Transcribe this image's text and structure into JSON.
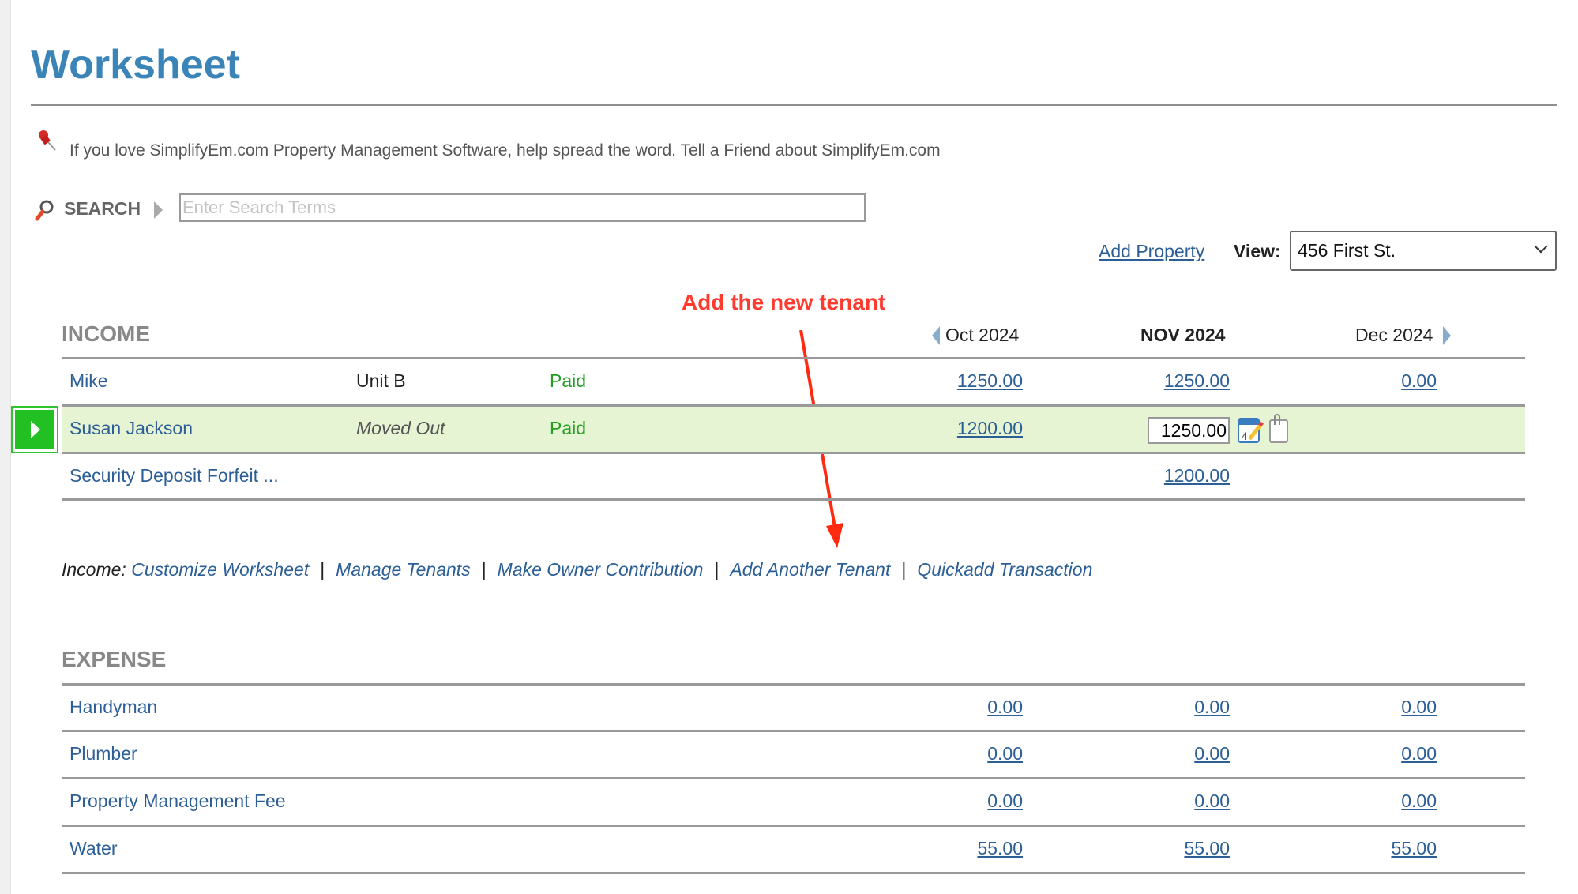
{
  "header": {
    "title": "Worksheet",
    "promo_text": "If you love SimplifyEm.com Property Management Software, help spread the word. Tell a Friend about SimplifyEm.com"
  },
  "search": {
    "label": "SEARCH",
    "placeholder": "Enter Search Terms",
    "value": ""
  },
  "toolbar": {
    "add_property": "Add Property",
    "view_label": "View:",
    "view_selected": "456 First St."
  },
  "annotation": {
    "text": "Add the new tenant",
    "color": "#ff3b30"
  },
  "months": {
    "prev": "Oct 2024",
    "current": "NOV 2024",
    "next": "Dec 2024"
  },
  "income": {
    "title": "INCOME",
    "rows": [
      {
        "name": "Mike",
        "unit": "Unit B",
        "status": "Paid",
        "oct": "1250.00",
        "nov": "1250.00",
        "dec": "0.00"
      },
      {
        "name": "Susan Jackson",
        "unit": "Moved Out",
        "status": "Paid",
        "oct": "1200.00",
        "nov_input": "1250.00",
        "dec": ""
      },
      {
        "name": "Security Deposit Forfeit  ...",
        "unit": "",
        "status": "",
        "oct": "",
        "nov": "1200.00",
        "dec": ""
      }
    ],
    "links_label": "Income:",
    "links": [
      "Customize Worksheet",
      "Manage Tenants",
      "Make Owner Contribution",
      "Add Another Tenant",
      "Quickadd Transaction"
    ],
    "separator": "|"
  },
  "expense": {
    "title": "EXPENSE",
    "rows": [
      {
        "name": "Handyman",
        "oct": "0.00",
        "nov": "0.00",
        "dec": "0.00"
      },
      {
        "name": "Plumber",
        "oct": "0.00",
        "nov": "0.00",
        "dec": "0.00"
      },
      {
        "name": "Property Management Fee",
        "oct": "0.00",
        "nov": "0.00",
        "dec": "0.00"
      },
      {
        "name": "Water",
        "oct": "55.00",
        "nov": "55.00",
        "dec": "55.00"
      }
    ]
  },
  "colors": {
    "title_blue": "#3a84b8",
    "link_blue": "#2c5f96",
    "paid_green": "#22a022",
    "selected_row_bg": "#e6f4d4"
  }
}
